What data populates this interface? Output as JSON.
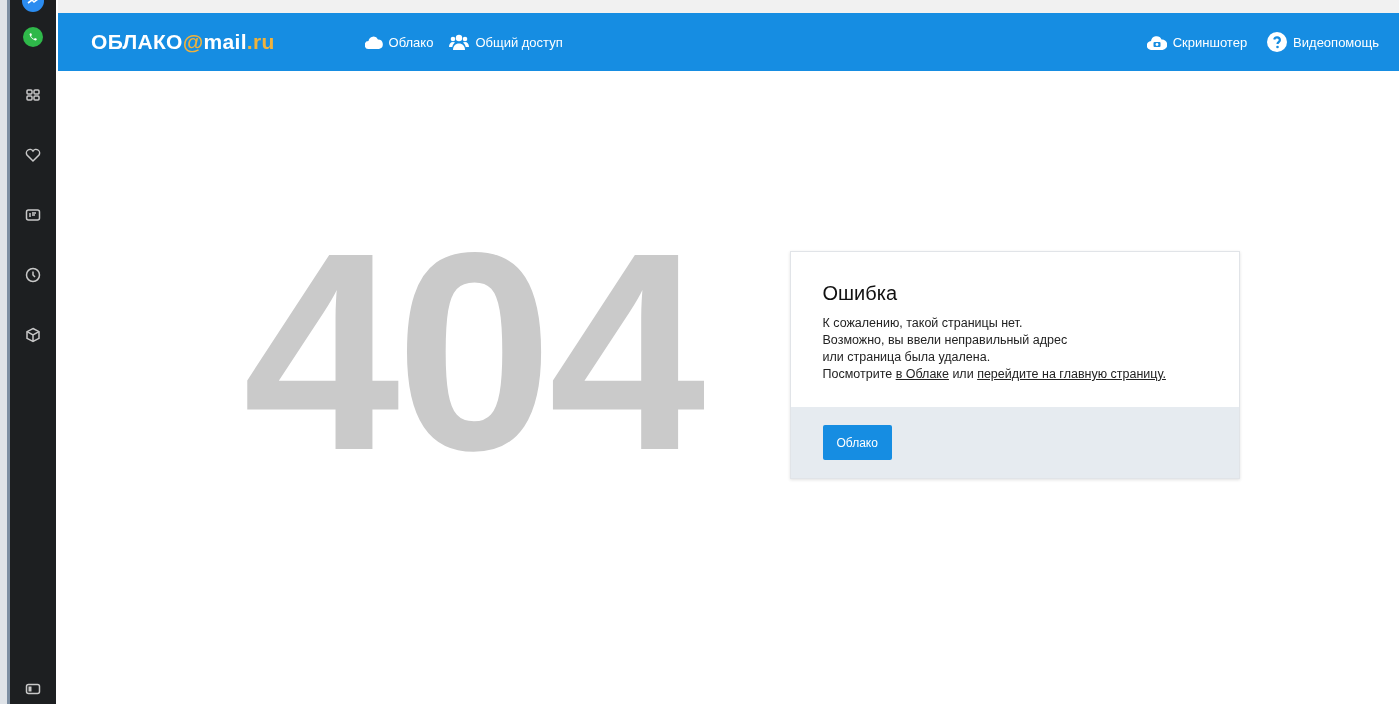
{
  "header": {
    "logo": [
      {
        "text": "ОБЛАКО",
        "accent": false
      },
      {
        "text": "@",
        "accent": true
      },
      {
        "text": "mail",
        "accent": false
      },
      {
        "text": ".ru",
        "accent": true
      }
    ],
    "nav": [
      {
        "label": "Облако"
      },
      {
        "label": "Общий доступ"
      }
    ],
    "actions": [
      {
        "label": "Скриншотер"
      },
      {
        "label": "Видеопомощь"
      }
    ]
  },
  "error_code": "404",
  "card": {
    "title": "Ошибка",
    "lines": [
      "К сожалению, такой страницы нет.",
      "Возможно, вы ввели неправильный адрес",
      "или страница была удалена."
    ],
    "last_line": [
      {
        "kind": "text",
        "text": "Посмотрите "
      },
      {
        "kind": "link",
        "text": "в Облаке"
      },
      {
        "kind": "text",
        "text": " или "
      },
      {
        "kind": "link",
        "text": "перейдите на главную страницу."
      }
    ],
    "button": "Облако"
  }
}
